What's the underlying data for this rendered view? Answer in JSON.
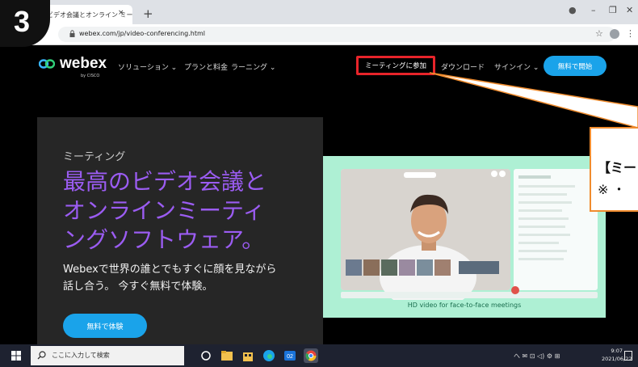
{
  "step": {
    "number": "3"
  },
  "browser": {
    "tab_title": "ビデオ会議とオンライン ミーティ",
    "tab_close": "×",
    "new_tab": "+",
    "url": "webex.com/jp/video-conferencing.html",
    "window_controls": {
      "minimize": "–",
      "restore": "❐",
      "close": "✕"
    },
    "nav": {
      "back": "←",
      "forward": "→",
      "reload": "C"
    },
    "star": "☆",
    "menu": "⋮"
  },
  "site": {
    "logo_text": "webex",
    "logo_sub": "by CISCO",
    "nav_items": [
      "ソリューション ⌄",
      "プランと料金",
      "ラーニング ⌄"
    ],
    "join_meeting": "ミーティングに参加",
    "download": "ダウンロード",
    "sign_in": "サインイン ⌄",
    "free_trial": "無料で開始"
  },
  "hero": {
    "eyebrow": "ミーティング",
    "title_lines": [
      "最高のビデオ会議と",
      "オンラインミーティ",
      "ングソフトウェア。"
    ],
    "desc_lines": [
      "Webexで世界の誰とでもすぐに顔を見ながら",
      "話し合う。 今すぐ無料で体験。"
    ],
    "cta": "無料で体験"
  },
  "video_panel": {
    "caption": "HD video for face-to-face meetings"
  },
  "callout": {
    "line1": "【ミー",
    "line2": "※ ・"
  },
  "taskbar": {
    "search_placeholder": "ここに入力して検索",
    "tray": "へ ✉ ⊡ ◁) ⚙ ⊞",
    "time": "9:07",
    "date": "2021/06/22"
  },
  "colors": {
    "accent_blue": "#1aa3ea",
    "highlight_red": "#e8242a",
    "hero_purple": "#9b5cf2",
    "callout_orange": "#f08c2e"
  }
}
